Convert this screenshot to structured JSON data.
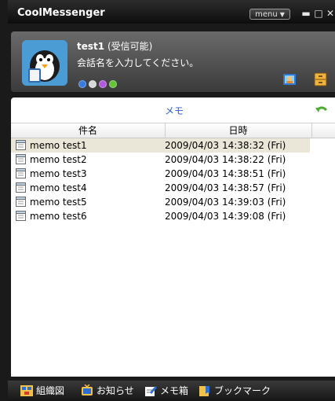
{
  "window": {
    "title": "CoolMessenger",
    "menu_label": "menu",
    "controls": [
      "minimize",
      "maximize",
      "close"
    ]
  },
  "profile": {
    "name": "test1",
    "status": "(受信可能)",
    "message": "会話名を入力してください。",
    "status_dots": [
      "#3a7be0",
      "#d8d8d8",
      "#b25adf",
      "#63c43a"
    ]
  },
  "memo_panel": {
    "title": "メモ",
    "columns": {
      "subject": "件名",
      "datetime": "日時"
    },
    "rows": [
      {
        "name": "memo test1",
        "date": "2009/04/03 14:38:32 (Fri)"
      },
      {
        "name": "memo test2",
        "date": "2009/04/03 14:38:22 (Fri)"
      },
      {
        "name": "memo test3",
        "date": "2009/04/03 14:38:51 (Fri)"
      },
      {
        "name": "memo test4",
        "date": "2009/04/03 14:38:57 (Fri)"
      },
      {
        "name": "memo test5",
        "date": "2009/04/03 14:39:03 (Fri)"
      },
      {
        "name": "memo test6",
        "date": "2009/04/03 14:39:08 (Fri)"
      }
    ]
  },
  "bottom_bar": {
    "org_chart": "組織図",
    "notice": "お知らせ",
    "memo_box": "メモ箱",
    "bookmark": "ブックマーク"
  }
}
